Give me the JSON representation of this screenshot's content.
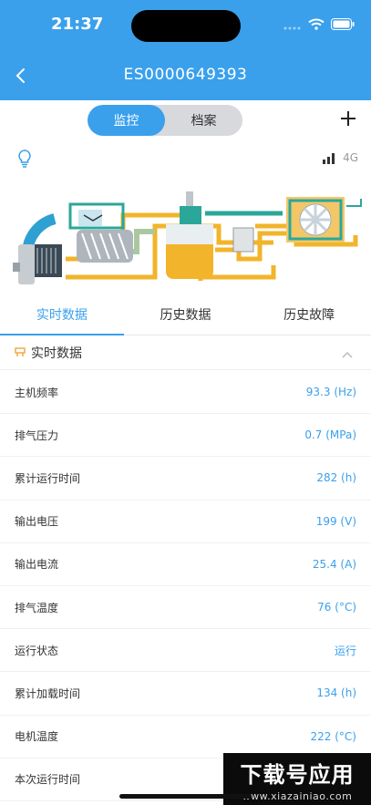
{
  "status_bar": {
    "time": "21:37"
  },
  "header": {
    "title": "ES0000649393"
  },
  "segment": {
    "options": [
      "监控",
      "档案"
    ],
    "active_index": 0
  },
  "network": {
    "label": "4G"
  },
  "tabs": [
    {
      "label": "实时数据",
      "active": true
    },
    {
      "label": "历史数据",
      "active": false
    },
    {
      "label": "历史故障",
      "active": false
    }
  ],
  "section": {
    "title": "实时数据"
  },
  "rows": [
    {
      "label": "主机频率",
      "value": "93.3 (Hz)"
    },
    {
      "label": "排气压力",
      "value": "0.7 (MPa)"
    },
    {
      "label": "累计运行时间",
      "value": "282 (h)"
    },
    {
      "label": "输出电压",
      "value": "199 (V)"
    },
    {
      "label": "输出电流",
      "value": "25.4 (A)"
    },
    {
      "label": "排气温度",
      "value": "76 (°C)"
    },
    {
      "label": "运行状态",
      "value": "运行"
    },
    {
      "label": "累计加载时间",
      "value": "134 (h)"
    },
    {
      "label": "电机温度",
      "value": "222 (°C)"
    },
    {
      "label": "本次运行时间",
      "value": ""
    }
  ],
  "watermark": {
    "main": "下载号应用",
    "sub": "www.xiazainiao.com"
  },
  "colors": {
    "primary": "#3aa0ec",
    "segment_bg": "#d7d9dd",
    "oil_yellow": "#f2b42a",
    "cooler_teal": "#2ba79a"
  }
}
